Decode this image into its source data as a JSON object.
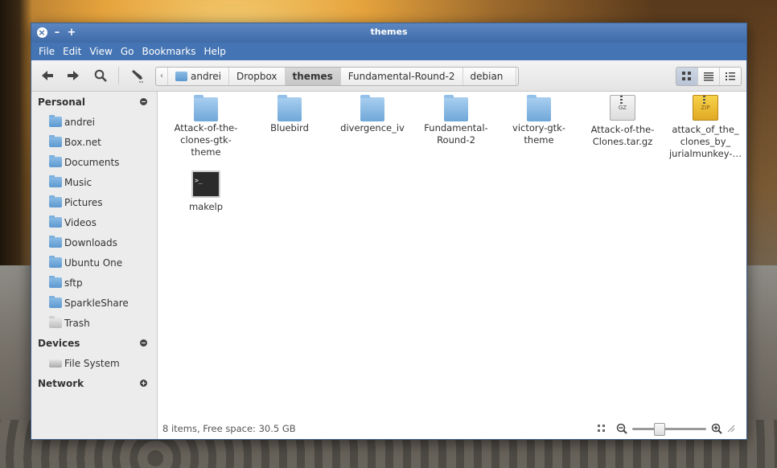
{
  "window": {
    "title": "themes"
  },
  "menu": [
    "File",
    "Edit",
    "View",
    "Go",
    "Bookmarks",
    "Help"
  ],
  "icons": {
    "back": "arrow-left-icon",
    "forward": "arrow-right-icon",
    "search": "search-icon",
    "edit_path": "pen-icon",
    "icon_view": "grid-icon",
    "list_view": "list-icon",
    "compact_view": "compact-list-icon"
  },
  "breadcrumbs": [
    "andrei",
    "Dropbox",
    "themes",
    "Fundamental-Round-2",
    "debian"
  ],
  "active_crumb": "themes",
  "sidebar": {
    "personal": {
      "header": "Personal",
      "items": [
        "andrei",
        "Box.net",
        "Documents",
        "Music",
        "Pictures",
        "Videos",
        "Downloads",
        "Ubuntu One",
        "sftp",
        "SparkleShare",
        "Trash"
      ]
    },
    "devices": {
      "header": "Devices",
      "items": [
        "File System"
      ]
    },
    "network": {
      "header": "Network"
    }
  },
  "files": [
    {
      "name": "Attack-of-the-clones-gtk-theme",
      "lines": [
        "Attack-of-the-",
        "clones-gtk-",
        "theme"
      ],
      "type": "folder"
    },
    {
      "name": "Bluebird",
      "lines": [
        "Bluebird"
      ],
      "type": "folder"
    },
    {
      "name": "divergence_iv",
      "lines": [
        "divergence_iv"
      ],
      "type": "folder"
    },
    {
      "name": "Fundamental-Round-2",
      "lines": [
        "Fundamental-",
        "Round-2"
      ],
      "type": "folder"
    },
    {
      "name": "victory-gtk-theme",
      "lines": [
        "victory-gtk-",
        "theme"
      ],
      "type": "folder"
    },
    {
      "name": "Attack-of-the-Clones.tar.gz",
      "lines": [
        "Attack-of-the-",
        "Clones.tar.gz"
      ],
      "type": "gz",
      "badge": "GZ"
    },
    {
      "name": "attack_of_the_clones_by_jurialmunkey",
      "lines": [
        "attack_of_the_",
        "clones_by_",
        "jurialmunkey-…"
      ],
      "type": "zip",
      "badge": "ZIP"
    },
    {
      "name": "makelp",
      "lines": [
        "makelp"
      ],
      "type": "script",
      "badge": ">_"
    }
  ],
  "status": {
    "text": "8 items, Free space: 30.5 GB"
  },
  "zoom": {
    "level": 0.35
  },
  "colors": {
    "titlebar": "#4474b3",
    "folder": "#6fa7d8"
  }
}
